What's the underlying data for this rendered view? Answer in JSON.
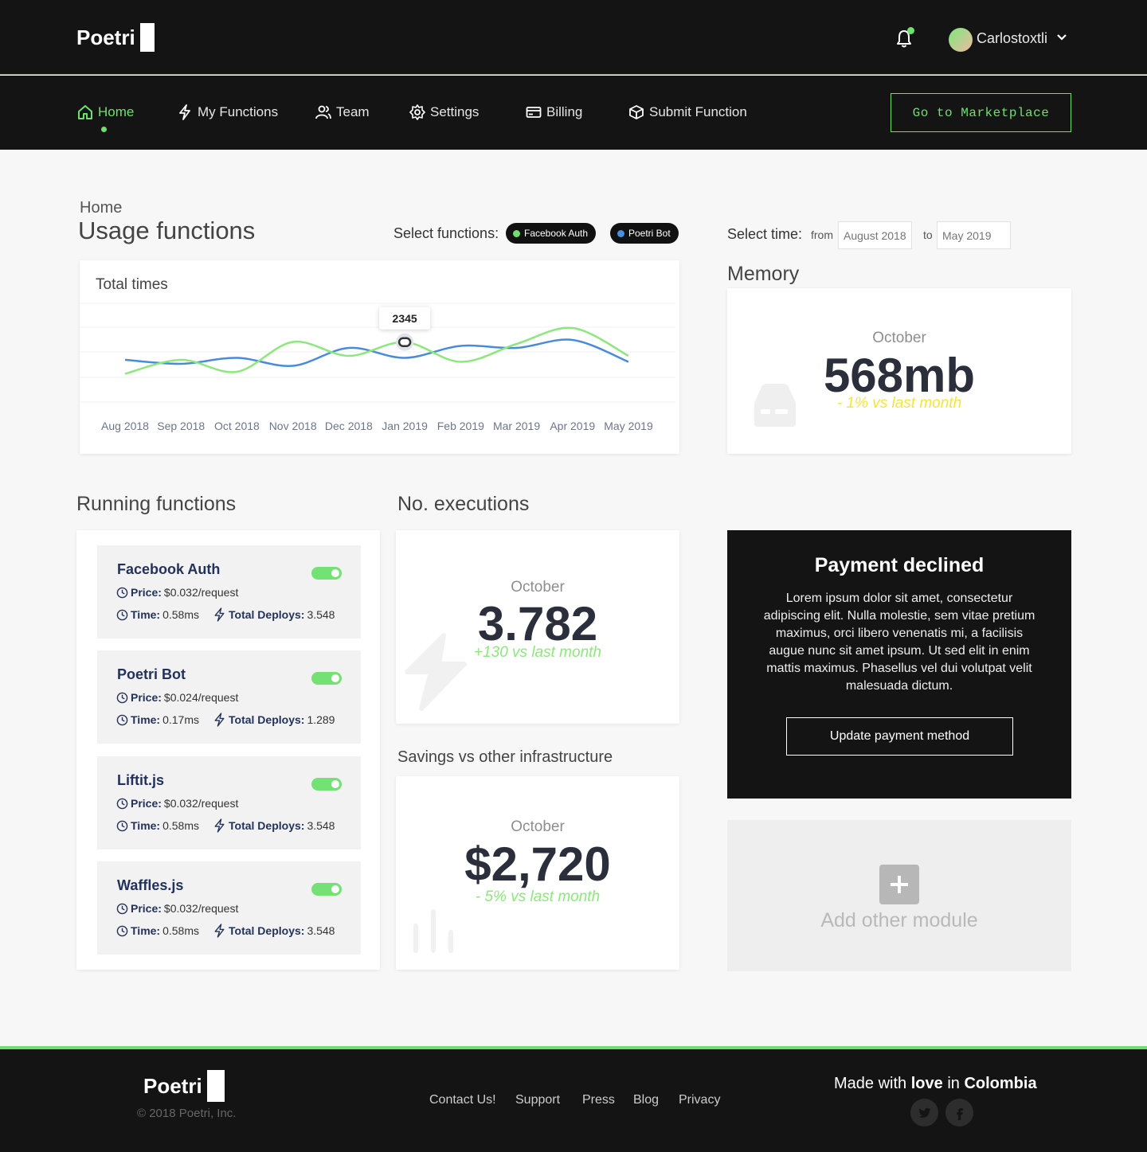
{
  "brand": {
    "name": "Poetri"
  },
  "header": {
    "username": "Carlostoxtli"
  },
  "nav": {
    "items": [
      {
        "label": "Home",
        "icon": "home-icon",
        "active": true
      },
      {
        "label": "My Functions",
        "icon": "lightning-icon"
      },
      {
        "label": "Team",
        "icon": "team-icon"
      },
      {
        "label": "Settings",
        "icon": "gear-icon"
      },
      {
        "label": "Billing",
        "icon": "credit-card-icon"
      },
      {
        "label": "Submit Function",
        "icon": "box-icon"
      }
    ],
    "cta": "Go to Marketplace"
  },
  "page": {
    "breadcrumb": "Home",
    "title": "Usage functions",
    "select_functions_label": "Select functions:",
    "function_pills": [
      {
        "label": "Facebook Auth",
        "color": "#6fe06d"
      },
      {
        "label": "Poetri Bot",
        "color": "#4a90e2"
      }
    ],
    "select_time_label": "Select time:",
    "from_label": "from",
    "from_placeholder": "August 2018",
    "to_label": "to",
    "to_placeholder": "May 2019"
  },
  "usage_chart": {
    "title": "Total times",
    "tooltip": "2345"
  },
  "chart_data": {
    "type": "line",
    "title": "Total times",
    "categories": [
      "Aug 2018",
      "Sep 2018",
      "Oct 2018",
      "Nov 2018",
      "Dec 2018",
      "Jan 2019",
      "Feb 2019",
      "Mar 2019",
      "Apr 2019",
      "May 2019"
    ],
    "series": [
      {
        "name": "Facebook Auth",
        "color": "#8ee67e",
        "values": [
          1550,
          1900,
          1600,
          2350,
          2000,
          2345,
          1850,
          2300,
          2700,
          2000
        ]
      },
      {
        "name": "Poetri Bot",
        "color": "#4a8bd9",
        "values": [
          1900,
          1800,
          1950,
          1750,
          2200,
          1950,
          2250,
          2200,
          2400,
          1850
        ]
      }
    ],
    "ylim": [
      1000,
      3200
    ],
    "highlight": {
      "category": "Jan 2019",
      "value": 2345
    },
    "grid": true
  },
  "memory": {
    "title": "Memory",
    "month": "October",
    "value": "568mb",
    "delta": "- 1% vs last month",
    "delta_color": "#f4e53c"
  },
  "running": {
    "title": "Running functions",
    "price_label": "Price:",
    "time_label": "Time:",
    "deploys_label": "Total Deploys:",
    "items": [
      {
        "name": "Facebook Auth",
        "price": "$0.032/request",
        "time": "0.58ms",
        "deploys": "3.548"
      },
      {
        "name": "Poetri Bot",
        "price": "$0.024/request",
        "time": "0.17ms",
        "deploys": "1.289"
      },
      {
        "name": "Liftit.js",
        "price": "$0.032/request",
        "time": "0.58ms",
        "deploys": "3.548"
      },
      {
        "name": "Waffles.js",
        "price": "$0.032/request",
        "time": "0.58ms",
        "deploys": "3.548"
      }
    ]
  },
  "executions": {
    "title": "No. executions",
    "month": "October",
    "value": "3.782",
    "delta": "+130 vs last month",
    "delta_color": "#8ee67e"
  },
  "savings": {
    "title": "Savings vs other infrastructure",
    "month": "October",
    "value": "$2,720",
    "delta": "- 5% vs last month",
    "delta_color": "#8ee67e"
  },
  "payment": {
    "title": "Payment declined",
    "text": "Lorem ipsum dolor sit amet, consectetur adipiscing elit. Nulla molestie, sem vitae pretium maximus, orci libero venenatis mi, a facilisis augue nunc sit amet ipsum. Ut sed elit in enim mattis maximus. Phasellus vel dui volutpat velit malesuada dictum.",
    "button": "Update payment method"
  },
  "add_module": {
    "label": "Add other module"
  },
  "footer": {
    "copyright": "© 2018 Poetri, Inc.",
    "links": [
      "Contact Us!",
      "Support",
      "Press",
      "Blog",
      "Privacy"
    ],
    "made_prefix": "Made with",
    "made_love": "love",
    "made_in": "in",
    "made_country": "Colombia"
  }
}
